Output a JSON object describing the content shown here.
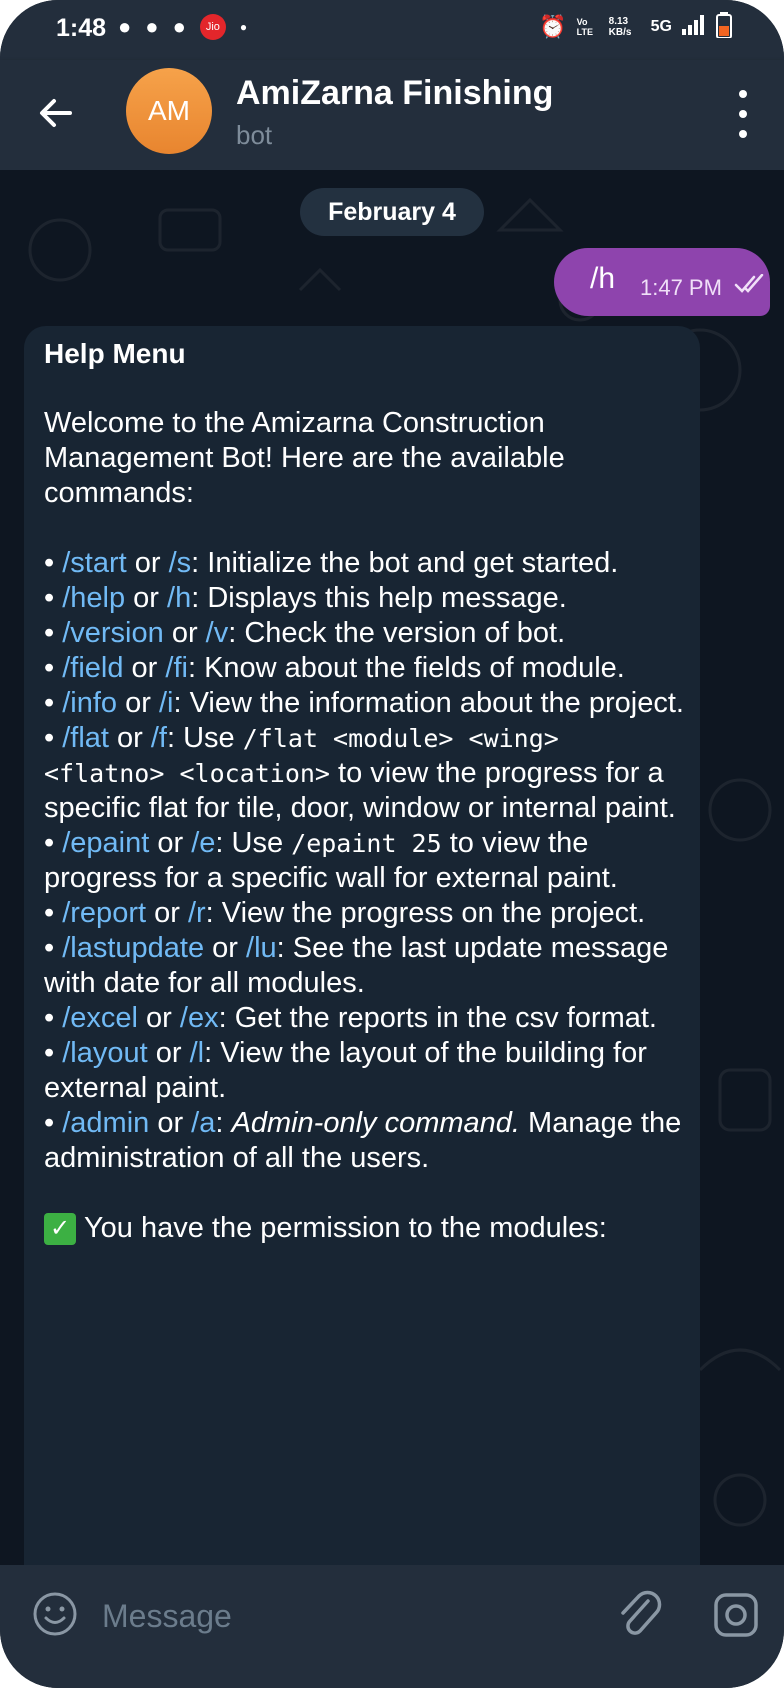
{
  "status_bar": {
    "time": "1:48",
    "network": "5G",
    "data_speed": "8.13 KB/s",
    "volte": "Vo LTE",
    "carrier_badge": "Jio"
  },
  "header": {
    "avatar_initials": "AM",
    "title": "AmiZarna Finishing",
    "subtitle": "bot"
  },
  "chat": {
    "date_separator": "February 4",
    "outgoing": {
      "text": "/h",
      "time": "1:47 PM"
    },
    "incoming": {
      "title": "Help Menu",
      "intro": "Welcome to the Amizarna Construction Management Bot! Here are the available commands:",
      "commands": [
        {
          "cmd": "/start",
          "or": " or ",
          "alias": "/s",
          "desc": ": Initialize the bot and get started."
        },
        {
          "cmd": "/help",
          "or": " or ",
          "alias": "/h",
          "desc": ": Displays this help message."
        },
        {
          "cmd": "/version",
          "or": " or ",
          "alias": "/v",
          "desc": ": Check the version of bot."
        },
        {
          "cmd": "/field",
          "or": " or ",
          "alias": "/fi",
          "desc": ": Know about the fields of module."
        },
        {
          "cmd": "/info",
          "or": " or ",
          "alias": "/i",
          "desc": ": View the information about the project."
        },
        {
          "cmd": "/flat",
          "or": " or ",
          "alias": "/f",
          "desc": ": Use ",
          "code": "/flat <module> <wing> <flatno> <location>",
          "desc2": " to view the progress for a specific flat for tile, door, window or internal paint."
        },
        {
          "cmd": "/epaint",
          "or": " or ",
          "alias": "/e",
          "desc": ": Use ",
          "code": "/epaint 25",
          "desc2": " to view the progress for a specific wall for external paint."
        },
        {
          "cmd": "/report",
          "or": " or ",
          "alias": "/r",
          "desc": ": View the progress on the project."
        },
        {
          "cmd": "/lastupdate",
          "or": " or ",
          "alias": "/lu",
          "desc": ": See the last update message with date for all modules."
        },
        {
          "cmd": "/excel",
          "or": " or ",
          "alias": "/ex",
          "desc": ": Get the reports in the csv format."
        },
        {
          "cmd": "/layout",
          "or": " or ",
          "alias": "/l",
          "desc": ": View the layout of the building for external paint."
        },
        {
          "cmd": "/admin",
          "or": " or ",
          "alias": "/a",
          "desc": ": ",
          "italic": "Admin-only command.",
          "desc2": " Manage the administration of all the users."
        }
      ],
      "permission_line": "You have the permission to the modules:"
    }
  },
  "input": {
    "placeholder": "Message"
  },
  "colors": {
    "header_bg": "#232e3c",
    "chat_bg": "#0e1621",
    "incoming_bubble": "#182533",
    "outgoing_bubble": "#8e44ad",
    "link": "#71baf5",
    "avatar": "#f0943a"
  }
}
